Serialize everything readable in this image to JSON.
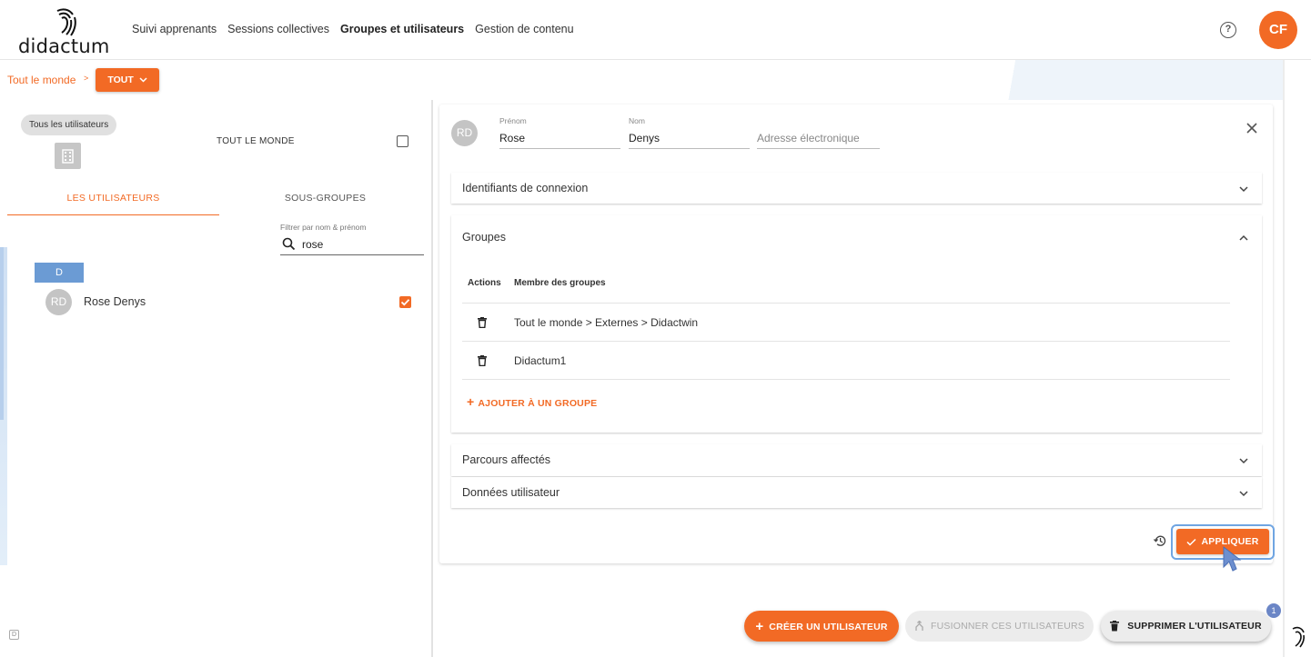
{
  "brand": {
    "logo_text": "didactum"
  },
  "nav": {
    "items": [
      {
        "label": "Suivi apprenants"
      },
      {
        "label": "Sessions collectives"
      },
      {
        "label": "Groupes et utilisateurs"
      },
      {
        "label": "Gestion de contenu"
      }
    ]
  },
  "header": {
    "help": "?",
    "avatar_initials": "CF"
  },
  "breadcrumb": {
    "root": "Tout le monde",
    "sep": ">",
    "dropdown": "TOUT"
  },
  "left": {
    "chip": "Tous les utilisateurs",
    "everyone_label": "TOUT LE MONDE",
    "tabs": {
      "users": "LES UTILISATEURS",
      "subgroups": "SOUS-GROUPES"
    },
    "filter_label": "Filtrer par nom & prénom",
    "search_value": "rose",
    "letter": "D",
    "users": [
      {
        "initials": "RD",
        "name": "Rose Denys"
      }
    ],
    "corner_letter": "D"
  },
  "card": {
    "initials": "RD",
    "first_name_label": "Prénom",
    "first_name": "Rose",
    "last_name_label": "Nom",
    "last_name": "Denys",
    "email_placeholder": "Adresse électronique",
    "sections": {
      "login": "Identifiants de connexion",
      "groups": "Groupes",
      "courses": "Parcours affectés",
      "user_data": "Données utilisateur"
    },
    "groups_table": {
      "col_actions": "Actions",
      "col_member": "Membre des groupes",
      "rows": [
        {
          "group": "Tout le monde > Externes > Didactwin"
        },
        {
          "group": "Didactum1"
        }
      ],
      "add_label": "AJOUTER À UN GROUPE"
    },
    "apply": "APPLIQUER"
  },
  "actions": {
    "create": "CRÉER UN UTILISATEUR",
    "merge": "FUSIONNER CES UTILISATEURS",
    "delete": "SUPPRIMER L'UTILISATEUR",
    "badge": "1"
  },
  "colors": {
    "accent": "#f26a25",
    "info": "#6b9bd4",
    "focus": "#6fa5e2"
  }
}
